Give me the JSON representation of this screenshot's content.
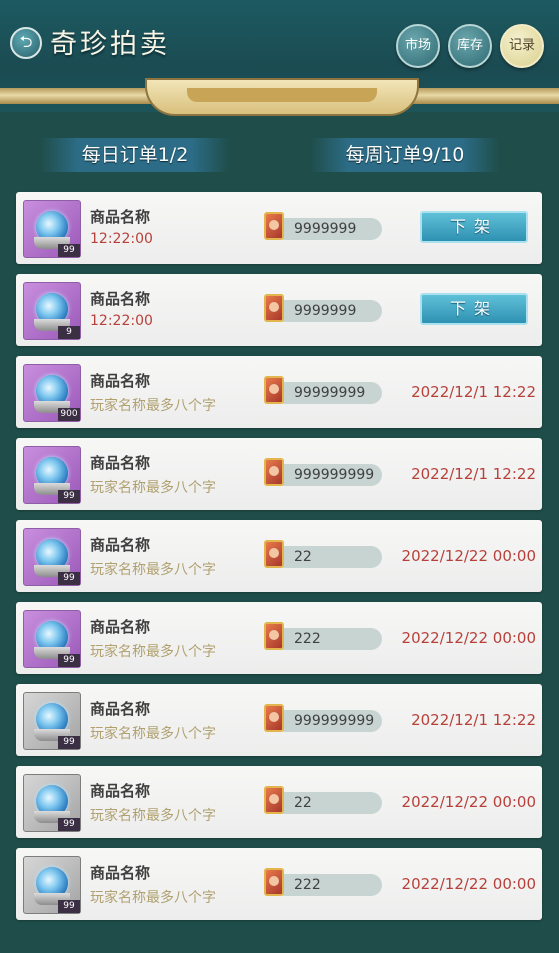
{
  "header": {
    "back_icon": "back-arrow-icon",
    "title": "奇珍拍卖",
    "buttons": [
      {
        "label": "市场"
      },
      {
        "label": "库存"
      },
      {
        "label": "记录"
      }
    ]
  },
  "quota": {
    "daily": "每日订单1/2",
    "weekly": "每周订单9/10"
  },
  "colors": {
    "accent_time": "#b8403a",
    "player_name": "#b1a170",
    "button_blue": "#2f91b2"
  },
  "rows": [
    {
      "name": "商品名称",
      "sub": "12:22:00",
      "qty": "99",
      "price": "9999999",
      "action": "下架",
      "rarity": "purple"
    },
    {
      "name": "商品名称",
      "sub": "12:22:00",
      "qty": "9",
      "price": "9999999",
      "action": "下架",
      "rarity": "purple"
    },
    {
      "name": "商品名称",
      "sub": "玩家名称最多八个字",
      "qty": "900",
      "price": "99999999",
      "date": "2022/12/1   12:22",
      "rarity": "purple"
    },
    {
      "name": "商品名称",
      "sub": "玩家名称最多八个字",
      "qty": "99",
      "price": "999999999",
      "date": "2022/12/1   12:22",
      "rarity": "purple"
    },
    {
      "name": "商品名称",
      "sub": "玩家名称最多八个字",
      "qty": "99",
      "price": "22",
      "date": "2022/12/22   00:00",
      "rarity": "purple"
    },
    {
      "name": "商品名称",
      "sub": "玩家名称最多八个字",
      "qty": "99",
      "price": "222",
      "date": "2022/12/22   00:00",
      "rarity": "purple"
    },
    {
      "name": "商品名称",
      "sub": "玩家名称最多八个字",
      "qty": "99",
      "price": "999999999",
      "date": "2022/12/1   12:22",
      "rarity": "gray"
    },
    {
      "name": "商品名称",
      "sub": "玩家名称最多八个字",
      "qty": "99",
      "price": "22",
      "date": "2022/12/22   00:00",
      "rarity": "gray"
    },
    {
      "name": "商品名称",
      "sub": "玩家名称最多八个字",
      "qty": "99",
      "price": "222",
      "date": "2022/12/22   00:00",
      "rarity": "gray"
    }
  ]
}
